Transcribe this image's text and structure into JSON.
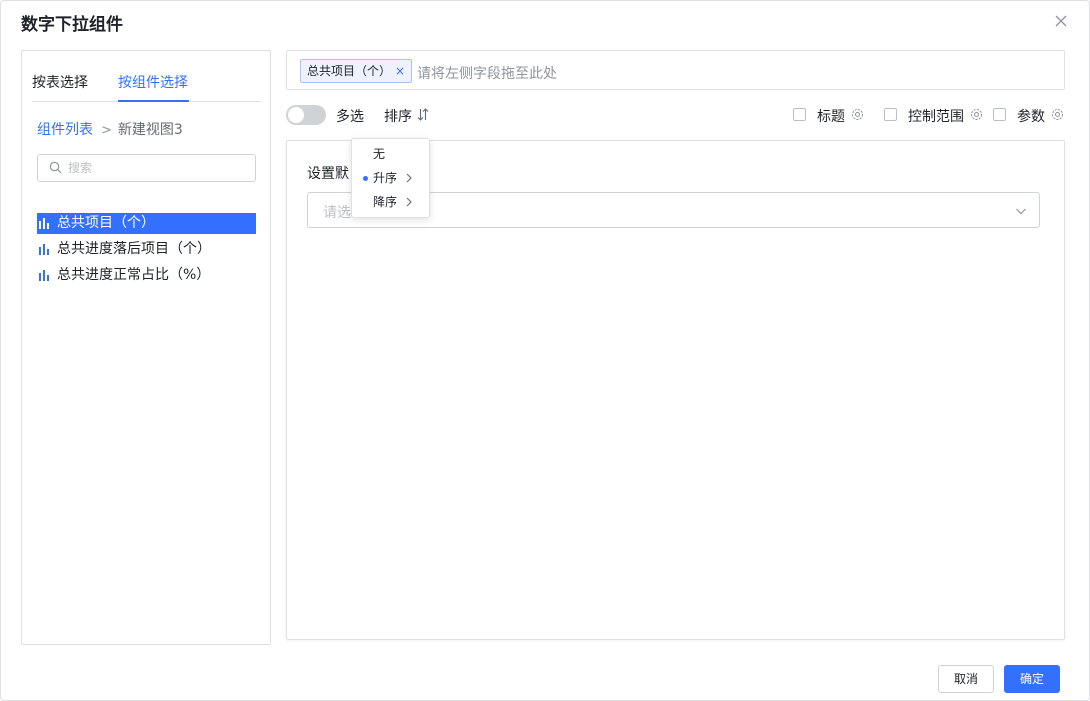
{
  "dialog": {
    "title": "数字下拉组件",
    "close_icon": "close-icon"
  },
  "left_panel": {
    "tabs": [
      {
        "label": "按表选择",
        "active": false
      },
      {
        "label": "按组件选择",
        "active": true
      }
    ],
    "breadcrumb": {
      "root": "组件列表",
      "separator": ">",
      "current": "新建视图3"
    },
    "search": {
      "placeholder": "搜索",
      "value": ""
    },
    "fields": [
      {
        "label": "总共项目（个）",
        "icon": "bar-chart-icon",
        "selected": true
      },
      {
        "label": "总共进度落后项目（个）",
        "icon": "bar-chart-icon",
        "selected": false
      },
      {
        "label": "总共进度正常占比（%）",
        "icon": "bar-chart-icon",
        "selected": false
      }
    ]
  },
  "dropzone": {
    "tag_label": "总共项目（个）",
    "tag_remove": "×",
    "hint": "请将左侧字段拖至此处"
  },
  "toolbar": {
    "multi_select_label": "多选",
    "multi_select_on": false,
    "sort_label": "排序",
    "checks": [
      {
        "label": "标题",
        "checked": false
      },
      {
        "label": "控制范围",
        "checked": false
      },
      {
        "label": "参数",
        "checked": false
      }
    ]
  },
  "sort_menu": {
    "items": [
      {
        "label": "无",
        "selected": false,
        "has_submenu": false
      },
      {
        "label": "升序",
        "selected": true,
        "has_submenu": true
      },
      {
        "label": "降序",
        "selected": false,
        "has_submenu": true
      }
    ]
  },
  "content": {
    "default_label": "设置默",
    "select_placeholder": "请选"
  },
  "footer": {
    "cancel_label": "取消",
    "ok_label": "确定"
  },
  "colors": {
    "accent": "#3370ff",
    "border": "#dee0e3",
    "text": "#1f2329",
    "muted": "#8f959e"
  }
}
